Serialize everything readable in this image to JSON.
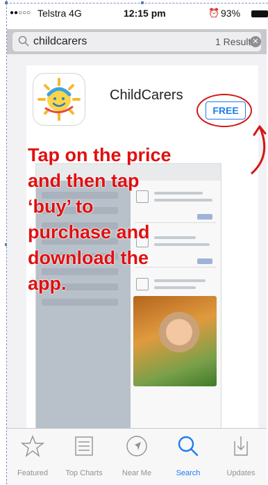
{
  "status_bar": {
    "signal": "●●○○○",
    "carrier": "Telstra  4G",
    "time": "12:15 pm",
    "battery": "93%"
  },
  "search": {
    "query": "childcarers",
    "result_count": "1 Result"
  },
  "app": {
    "name": "ChildCarers",
    "price_button": "FREE"
  },
  "instruction_lines": [
    "Tap on the price",
    "and then tap",
    "‘buy’ to",
    "purchase and",
    "download the",
    "app."
  ],
  "tab_bar": {
    "tabs": [
      {
        "label": "Featured",
        "icon": "star-icon"
      },
      {
        "label": "Top Charts",
        "icon": "list-icon"
      },
      {
        "label": "Near Me",
        "icon": "location-icon"
      },
      {
        "label": "Search",
        "icon": "search-icon"
      },
      {
        "label": "Updates",
        "icon": "updates-icon"
      }
    ],
    "active": "Search"
  },
  "colors": {
    "accent": "#1a7cf0",
    "annotation": "#e01010"
  }
}
